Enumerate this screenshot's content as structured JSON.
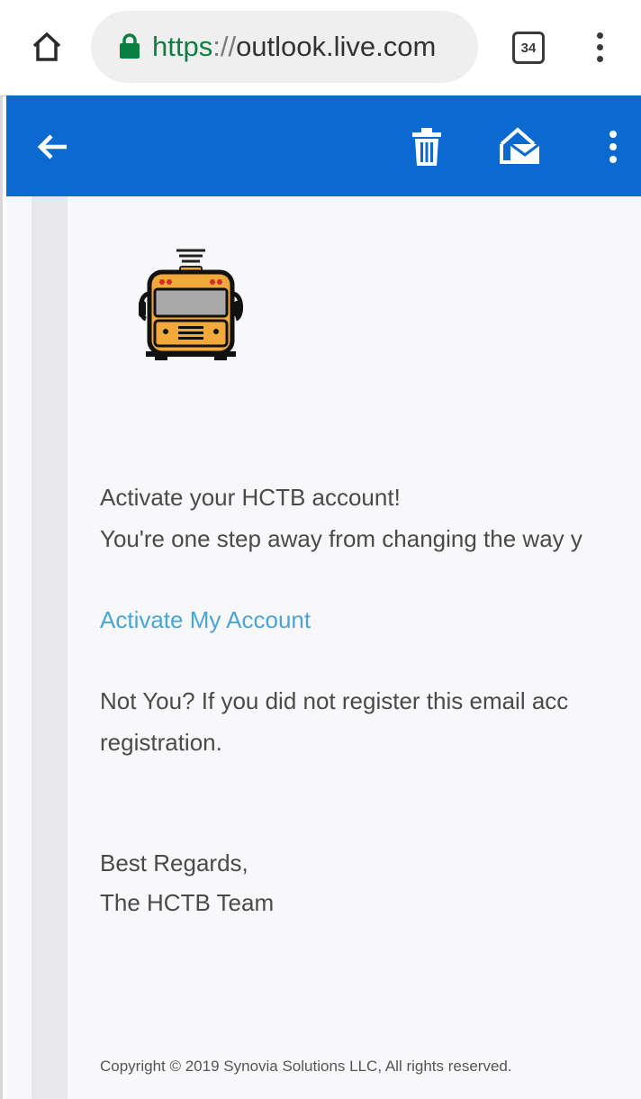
{
  "browser": {
    "url_scheme": "https",
    "url_separator": "://",
    "url_host": "outlook.live.com",
    "tab_count": "34",
    "icons": {
      "home": "home-icon",
      "lock": "lock-icon",
      "tabs": "tab-switcher-icon",
      "menu": "more-vertical-icon"
    },
    "colors": {
      "lock": "#0b8043"
    }
  },
  "app_bar": {
    "color": "#0a6ad0",
    "icons": {
      "back": "arrow-left-icon",
      "delete": "trash-icon",
      "unread": "mark-unread-icon",
      "menu": "more-vertical-icon"
    }
  },
  "email": {
    "logo": "school-bus-logo",
    "heading": "Activate your HCTB account!",
    "line2": "You're one step away from changing the way y",
    "link_text": "Activate My Account",
    "notice_line1": "Not You? If you did not register this email acc",
    "notice_line2": "registration.",
    "sign_off": "Best Regards,",
    "signature": "The HCTB Team",
    "copyright": "Copyright © 2019 Synovia Solutions LLC, All rights reserved.",
    "colors": {
      "link": "#4aa4d8",
      "text": "#4a4a4a"
    }
  }
}
